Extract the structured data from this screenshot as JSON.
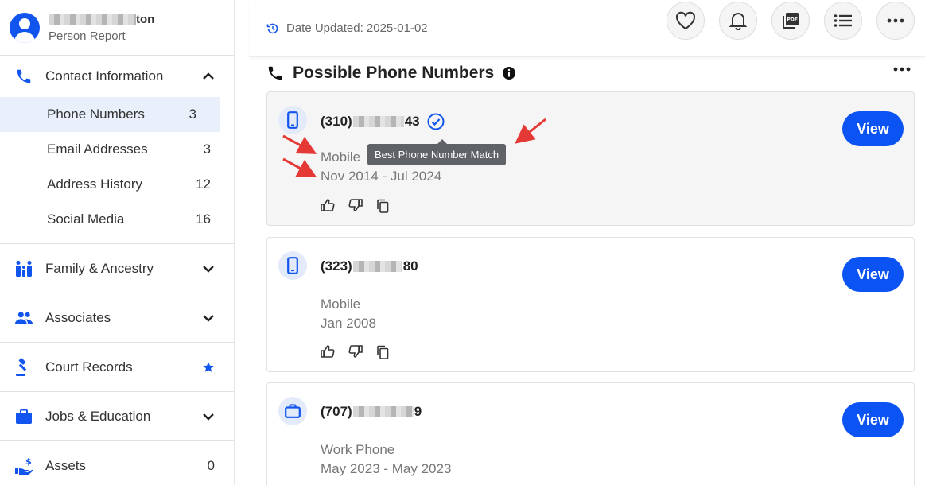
{
  "profile": {
    "name_suffix": "ton",
    "subtitle": "Person Report"
  },
  "sidebar": {
    "contact": {
      "label": "Contact Information",
      "items": [
        {
          "label": "Phone Numbers",
          "count": "3"
        },
        {
          "label": "Email Addresses",
          "count": "3"
        },
        {
          "label": "Address History",
          "count": "12"
        },
        {
          "label": "Social Media",
          "count": "16"
        }
      ]
    },
    "sections": [
      {
        "label": "Family & Ancestry",
        "icon": "family-icon"
      },
      {
        "label": "Associates",
        "icon": "group-icon"
      },
      {
        "label": "Court Records",
        "icon": "gavel-icon"
      },
      {
        "label": "Jobs & Education",
        "icon": "briefcase-icon"
      },
      {
        "label": "Assets",
        "icon": "money-hand-icon",
        "count": "0"
      }
    ]
  },
  "header": {
    "date_updated": "Date Updated: 2025-01-02",
    "actions": [
      "heart-icon",
      "bell-icon",
      "pdf-icon",
      "list-icon",
      "more-icon"
    ]
  },
  "main": {
    "title": "Possible Phone Numbers",
    "view_label": "View",
    "tooltip": "Best Phone Number Match",
    "cards": [
      {
        "prefix": "(310)",
        "suffix": "43",
        "type": "Mobile",
        "dates": "Nov 2014 - Jul 2024",
        "icon": "mobile-phone-icon"
      },
      {
        "prefix": "(323)",
        "suffix": "80",
        "type": "Mobile",
        "dates": "Jan 2008",
        "icon": "mobile-phone-icon"
      },
      {
        "prefix": "(707)",
        "suffix": "9",
        "type": "Work Phone",
        "dates": "May 2023 - May 2023",
        "icon": "briefcase-icon"
      }
    ]
  },
  "colors": {
    "accent": "#0b53f2",
    "annotation": "#e53935"
  }
}
